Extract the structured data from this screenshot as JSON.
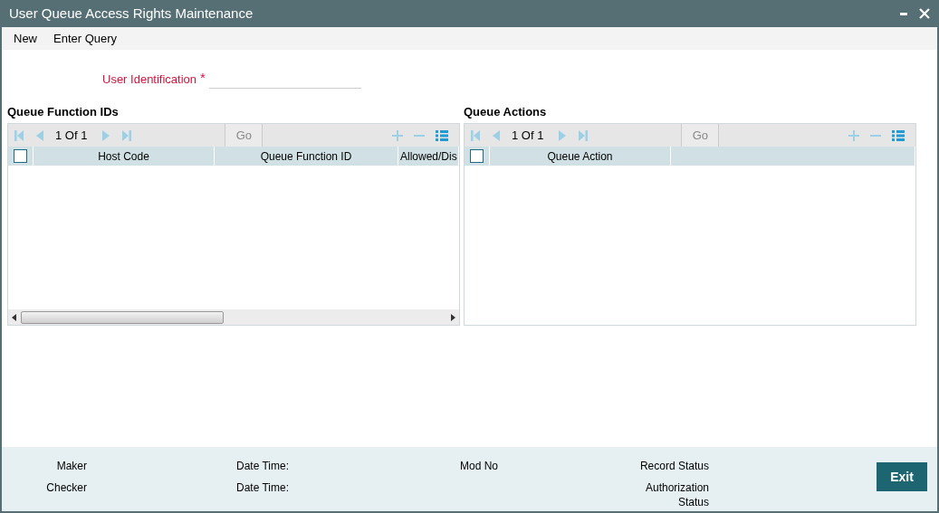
{
  "window": {
    "title": "User Queue Access Rights Maintenance"
  },
  "menu": [
    {
      "label": "New"
    },
    {
      "label": "Enter Query"
    }
  ],
  "user_identification": {
    "label": "User Identification",
    "required_marker": "*"
  },
  "grids": [
    {
      "title": "Queue Function IDs",
      "pager": "1 Of 1",
      "go": "Go",
      "select_all_checked": false,
      "horizontal_scrollbar": true,
      "columns": [
        {
          "label": "Host Code"
        },
        {
          "label": "Queue Function ID"
        },
        {
          "label": "Allowed/Dis"
        }
      ]
    },
    {
      "title": "Queue Actions",
      "pager": "1 Of 1",
      "go": "Go",
      "select_all_checked": false,
      "columns": [
        {
          "label": "Queue Action"
        },
        {}
      ]
    }
  ],
  "footer": {
    "maker": "Maker",
    "checker": "Checker",
    "date_time_1": "Date Time:",
    "date_time_2": "Date Time:",
    "mod_no": "Mod No",
    "record_status": "Record Status",
    "authorization_status": "Authorization\nStatus",
    "exit": "Exit"
  }
}
